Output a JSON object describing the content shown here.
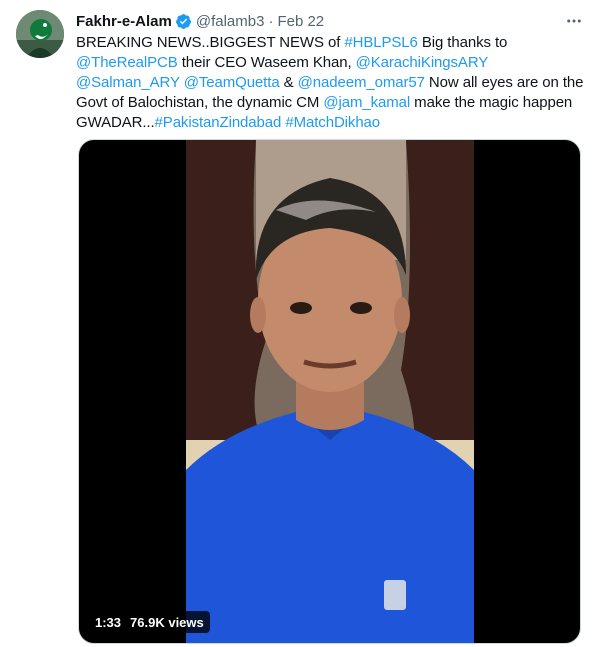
{
  "tweet": {
    "author_name": "Fakhr-e-Alam",
    "handle": "@falamb3",
    "separator": "·",
    "date": "Feb 22",
    "text_segments": [
      {
        "t": "BREAKING NEWS..BIGGEST NEWS of ",
        "link": false
      },
      {
        "t": "#HBLPSL6",
        "link": true
      },
      {
        "t": " Big thanks to ",
        "link": false
      },
      {
        "t": "@TheRealPCB",
        "link": true
      },
      {
        "t": " their CEO Waseem Khan, ",
        "link": false
      },
      {
        "t": "@KarachiKingsARY",
        "link": true
      },
      {
        "t": " ",
        "link": false
      },
      {
        "t": "@Salman_ARY",
        "link": true
      },
      {
        "t": " ",
        "link": false
      },
      {
        "t": "@TeamQuetta",
        "link": true
      },
      {
        "t": " & ",
        "link": false
      },
      {
        "t": "@nadeem_omar57",
        "link": true
      },
      {
        "t": " Now all eyes are on the Govt of Balochistan, the dynamic CM ",
        "link": false
      },
      {
        "t": "@jam_kamal",
        "link": true
      },
      {
        "t": " make the magic happen GWADAR...",
        "link": false
      },
      {
        "t": "#PakistanZindabad",
        "link": true
      },
      {
        "t": " ",
        "link": false
      },
      {
        "t": "#MatchDikhao",
        "link": true
      }
    ],
    "video": {
      "duration": "1:33",
      "views": "76.9K views"
    }
  },
  "icons": {
    "verified": "verified-badge-icon",
    "more": "more-options-icon"
  },
  "colors": {
    "link": "#1d9bf0",
    "verified": "#1d9bf0",
    "secondary_text": "#536471",
    "shirt": "#1f55d8"
  }
}
